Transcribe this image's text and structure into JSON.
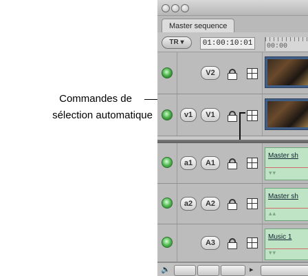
{
  "callout": {
    "line1": "Commandes de",
    "line2": "sélection automatique"
  },
  "window": {
    "tab_label": "Master sequence",
    "tr_label": "TR",
    "timecode": "01:00:10:01",
    "ruler_label": "00:00"
  },
  "tracks": [
    {
      "kind": "video",
      "src_label": "",
      "dst_label": "V2"
    },
    {
      "kind": "video",
      "src_label": "v1",
      "dst_label": "V1"
    },
    {
      "kind": "audio",
      "src_label": "a1",
      "dst_label": "A1",
      "clip_name": "Master sh"
    },
    {
      "kind": "audio",
      "src_label": "a2",
      "dst_label": "A2",
      "clip_name": "Master sh"
    },
    {
      "kind": "audio",
      "src_label": "",
      "dst_label": "A3",
      "clip_name": "Music 1"
    }
  ],
  "colors": {
    "enable_green": "#3fa33f",
    "audio_clip": "#bfe3c5",
    "video_clip": "#405f88"
  },
  "icons": {
    "enable": "green-dot-icon",
    "lock": "lock-icon",
    "autoselect": "grid-icon",
    "speaker": "speaker-icon"
  }
}
